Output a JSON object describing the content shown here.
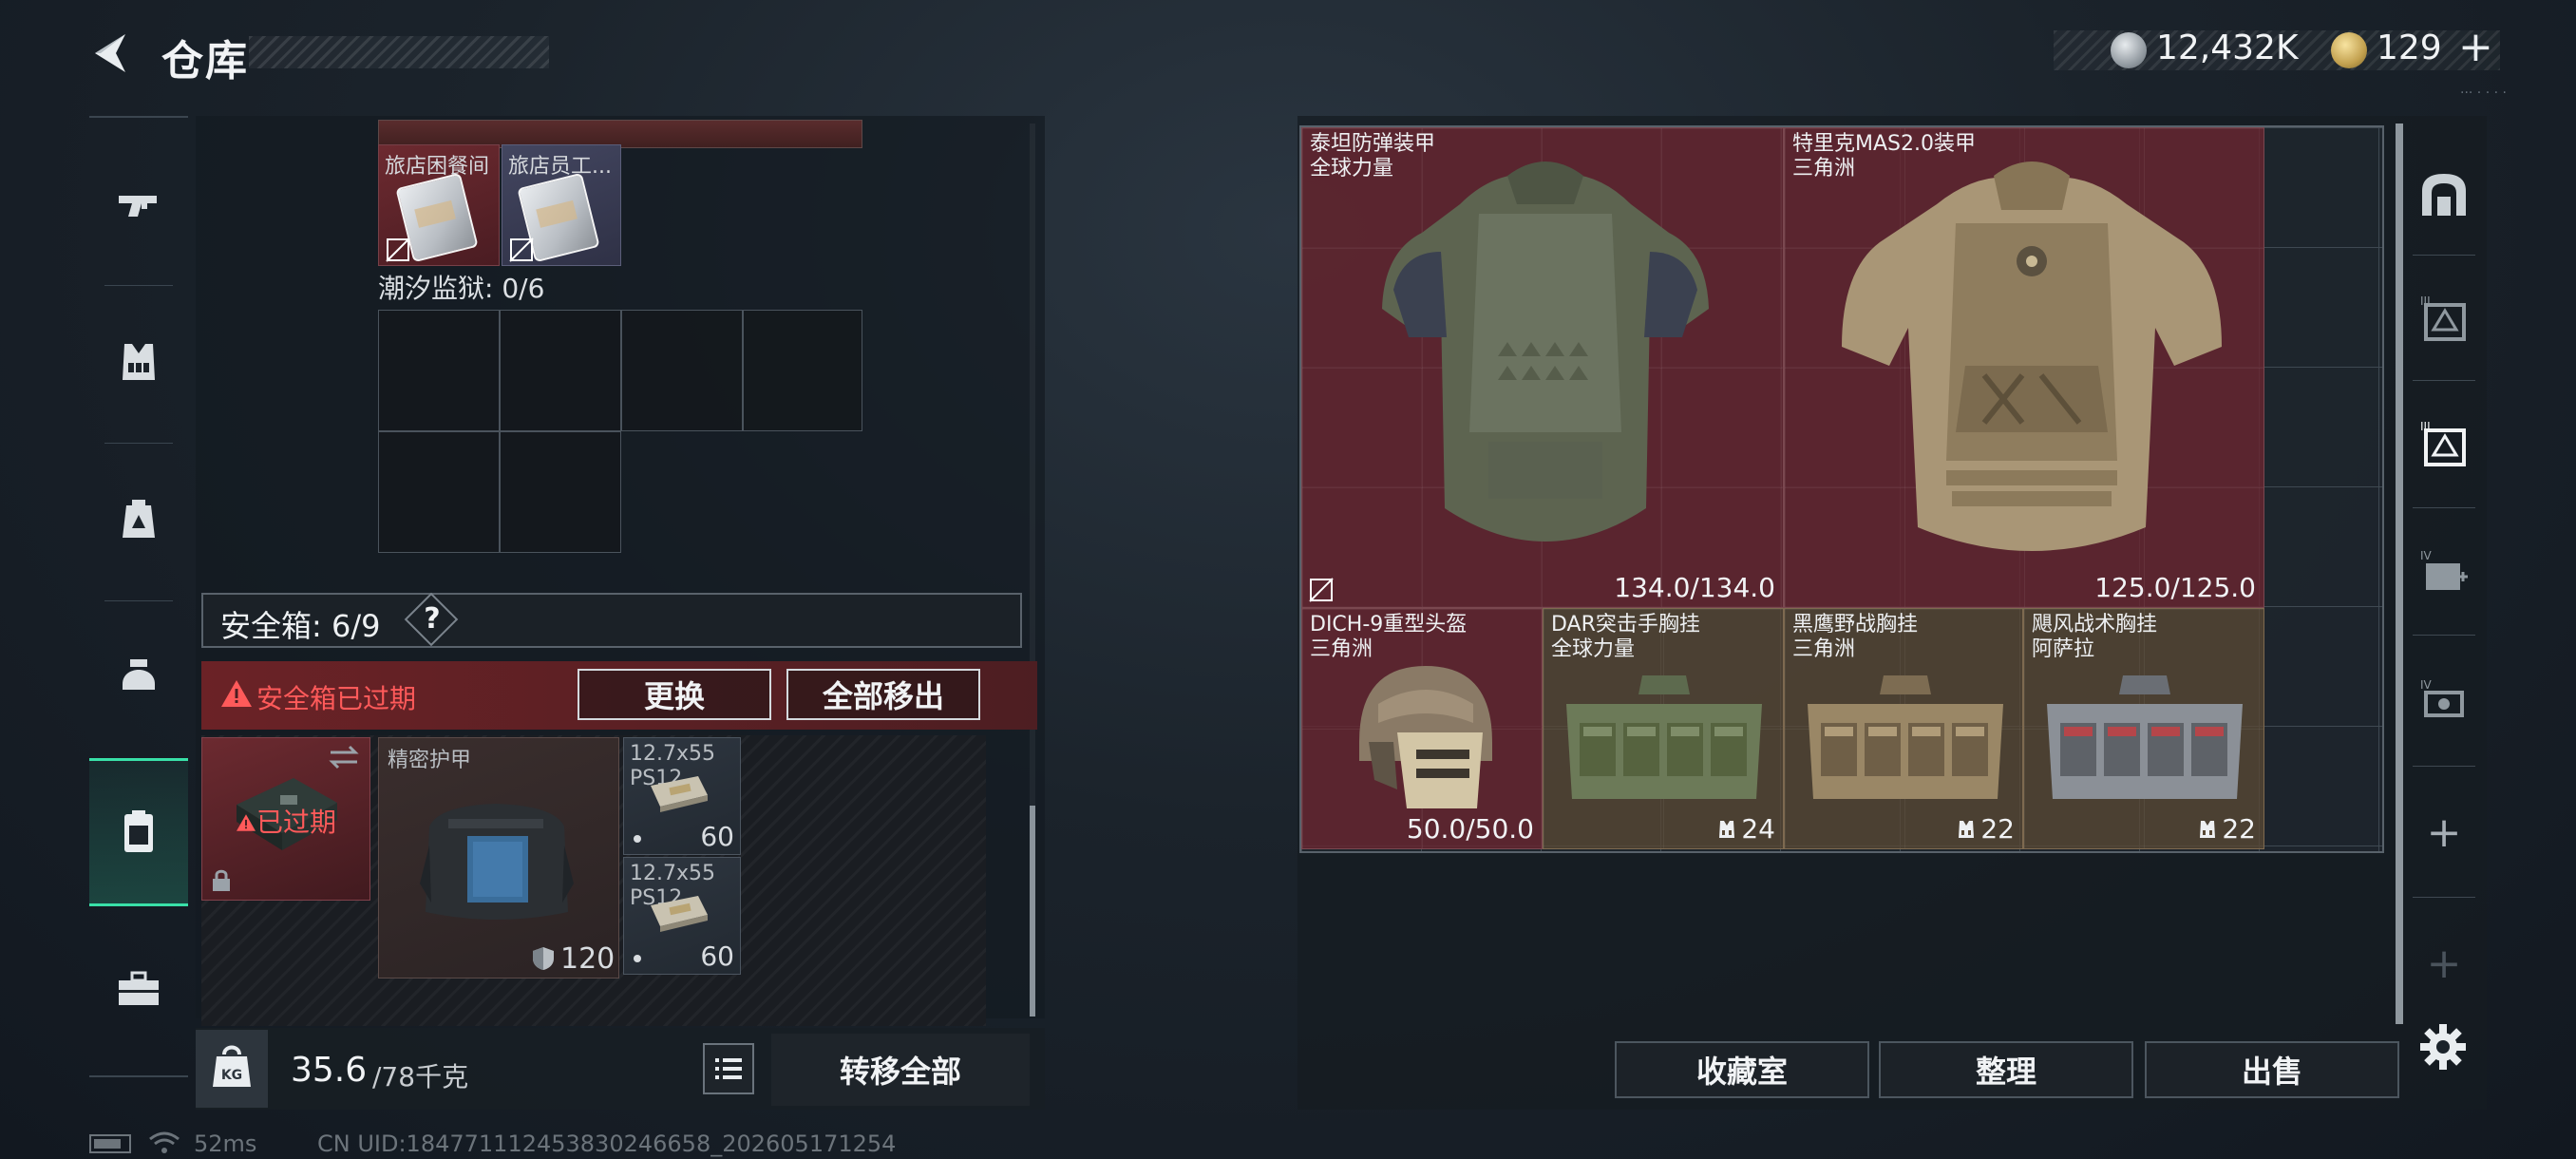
{
  "header": {
    "title": "仓库",
    "currency_silver": "12,432K",
    "currency_gold": "129",
    "add_label": "+",
    "tiny_text": "··· · · · ·"
  },
  "left_nav": {
    "items": [
      "weapons",
      "armor-rig",
      "backpack",
      "helmet",
      "safe-box",
      "toolbox"
    ],
    "active": "safe-box"
  },
  "backpack": {
    "top_items": [
      {
        "name": "旅店困餐间",
        "rarity": "red"
      },
      {
        "name": "旅店员工...",
        "rarity": "violet"
      }
    ],
    "section_label": "潮汐监狱: 0/6",
    "safe_box_label": "安全箱: 6/9",
    "help_label": "?",
    "warning_text": "安全箱已过期",
    "swap_label": "更换",
    "move_all_out_label": "全部移出",
    "safe_item_status": "已过期",
    "armor_item": {
      "name": "精密护甲",
      "value": "120"
    },
    "ammo": [
      {
        "name": "12.7x55\nPS12",
        "count": "60"
      },
      {
        "name": "12.7x55\nPS12",
        "count": "60"
      }
    ],
    "weight_current": "35.6",
    "weight_max": "/78千克",
    "transfer_all_label": "转移全部"
  },
  "status_bar": {
    "ping": "52ms",
    "uid": "CN UID:18477111245383024665​8_202605171254"
  },
  "stash": {
    "items": [
      {
        "name": "泰坦防弹装甲",
        "sub": "全球力量",
        "value": "134.0/134.0",
        "rarity": "red"
      },
      {
        "name": "特里克MAS2.0装甲",
        "sub": "三角洲",
        "value": "125.0/125.0",
        "rarity": "red"
      },
      {
        "name": "DICH-9重型头盔",
        "sub": "三角洲",
        "value": "50.0/50.0",
        "rarity": "red"
      },
      {
        "name": "DAR突击手胸挂",
        "sub": "全球力量",
        "value": "24",
        "rarity": "gold"
      },
      {
        "name": "黑鹰野战胸挂",
        "sub": "三角洲",
        "value": "22",
        "rarity": "gold"
      },
      {
        "name": "飓风战术胸挂",
        "sub": "阿萨拉",
        "value": "22",
        "rarity": "gold"
      }
    ],
    "collect_label": "收藏室",
    "sort_label": "整理",
    "sell_label": "出售"
  },
  "right_nav": {
    "items": [
      "armor-stash",
      "tier-iii-armor",
      "tier-iii-rig",
      "tier-iv-medical",
      "tier-iv-camera"
    ],
    "plus_label": "+"
  },
  "colors": {
    "accent_green": "#39e0a8",
    "rarity_red": "#682630",
    "rarity_gold": "#584834",
    "warning_red": "#ff5a5a"
  }
}
